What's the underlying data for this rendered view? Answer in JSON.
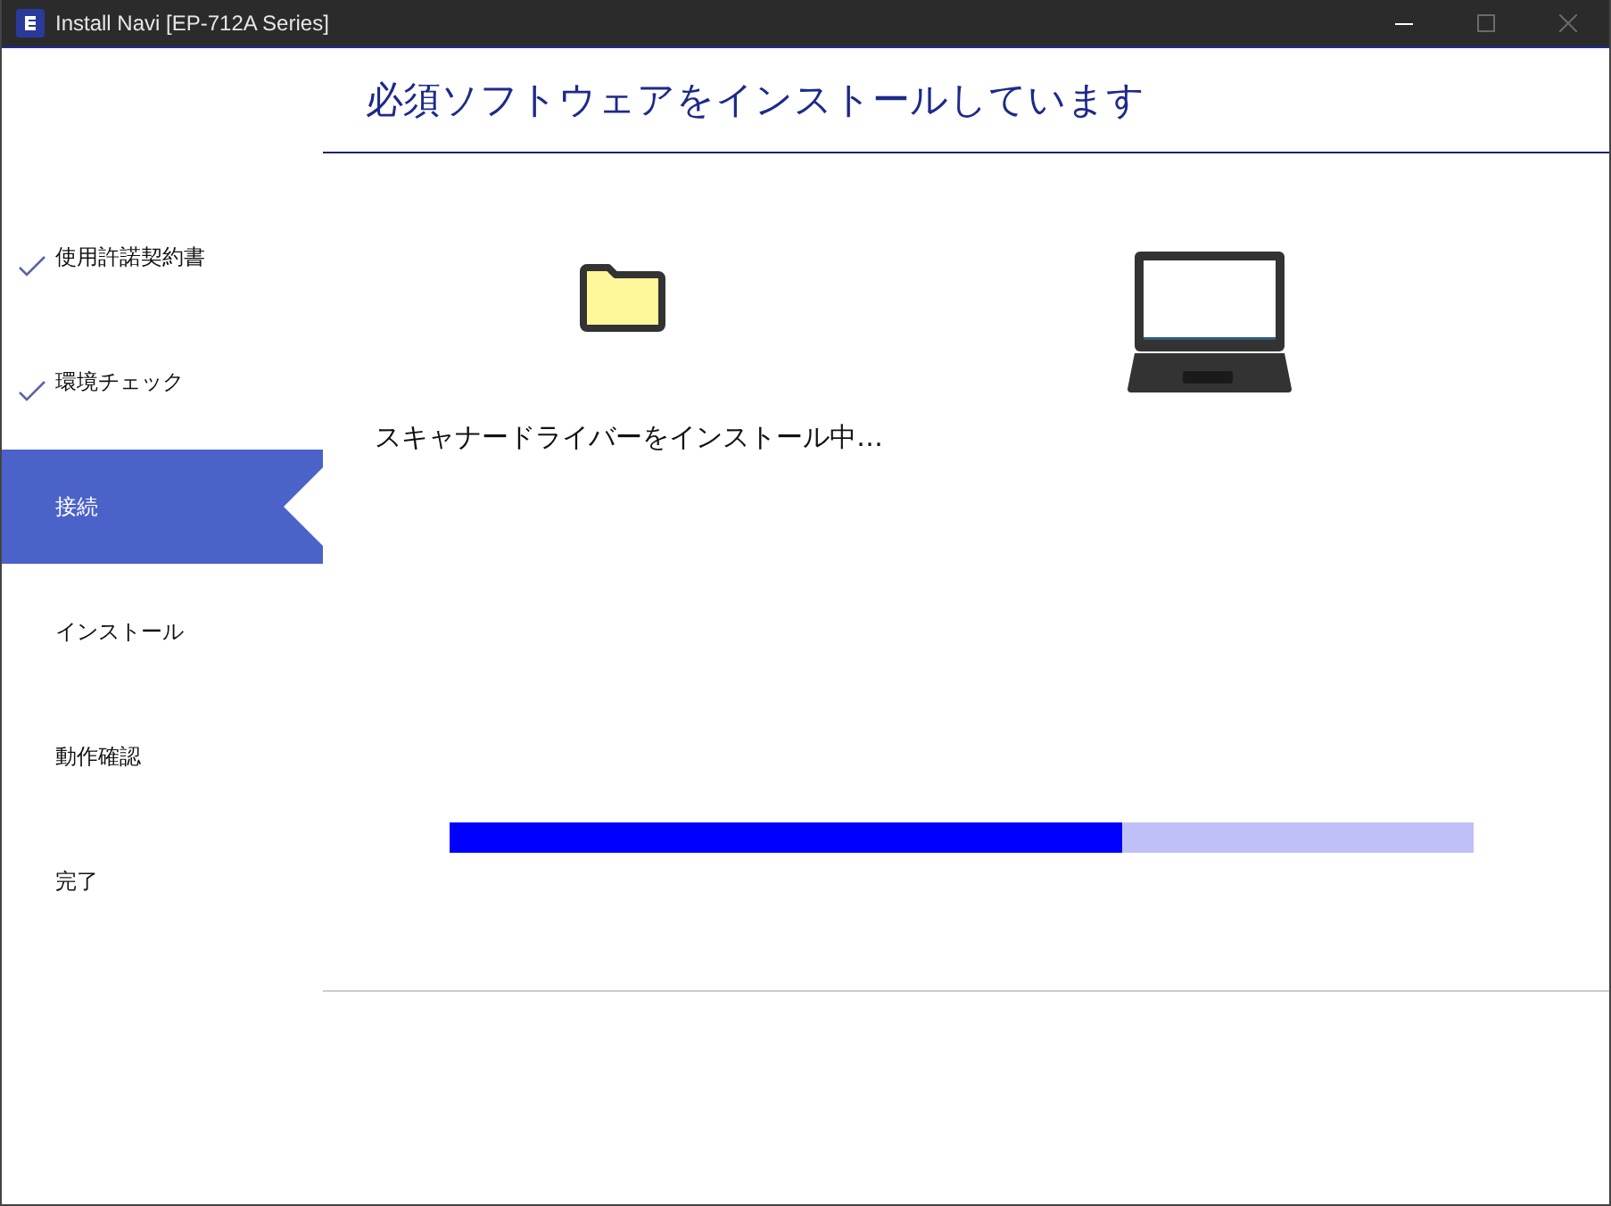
{
  "window": {
    "title": "Install Navi [EP-712A Series]",
    "controls": [
      {
        "kind": "minimize",
        "disabled": false
      },
      {
        "kind": "maximize",
        "disabled": true
      },
      {
        "kind": "close",
        "disabled": true
      }
    ]
  },
  "steps": [
    {
      "label": "使用許諾契約書",
      "done": true,
      "selected": false
    },
    {
      "label": "環境チェック",
      "done": true,
      "selected": false
    },
    {
      "label": "接続",
      "done": false,
      "selected": true
    },
    {
      "label": "インストール",
      "done": false,
      "selected": false
    },
    {
      "label": "動作確認",
      "done": false,
      "selected": false
    },
    {
      "label": "完了",
      "done": false,
      "selected": false
    }
  ],
  "heading": "必須ソフトウェアをインストールしています",
  "status": "スキャナードライバーをインストール中…",
  "progress": {
    "level": 0.657
  }
}
